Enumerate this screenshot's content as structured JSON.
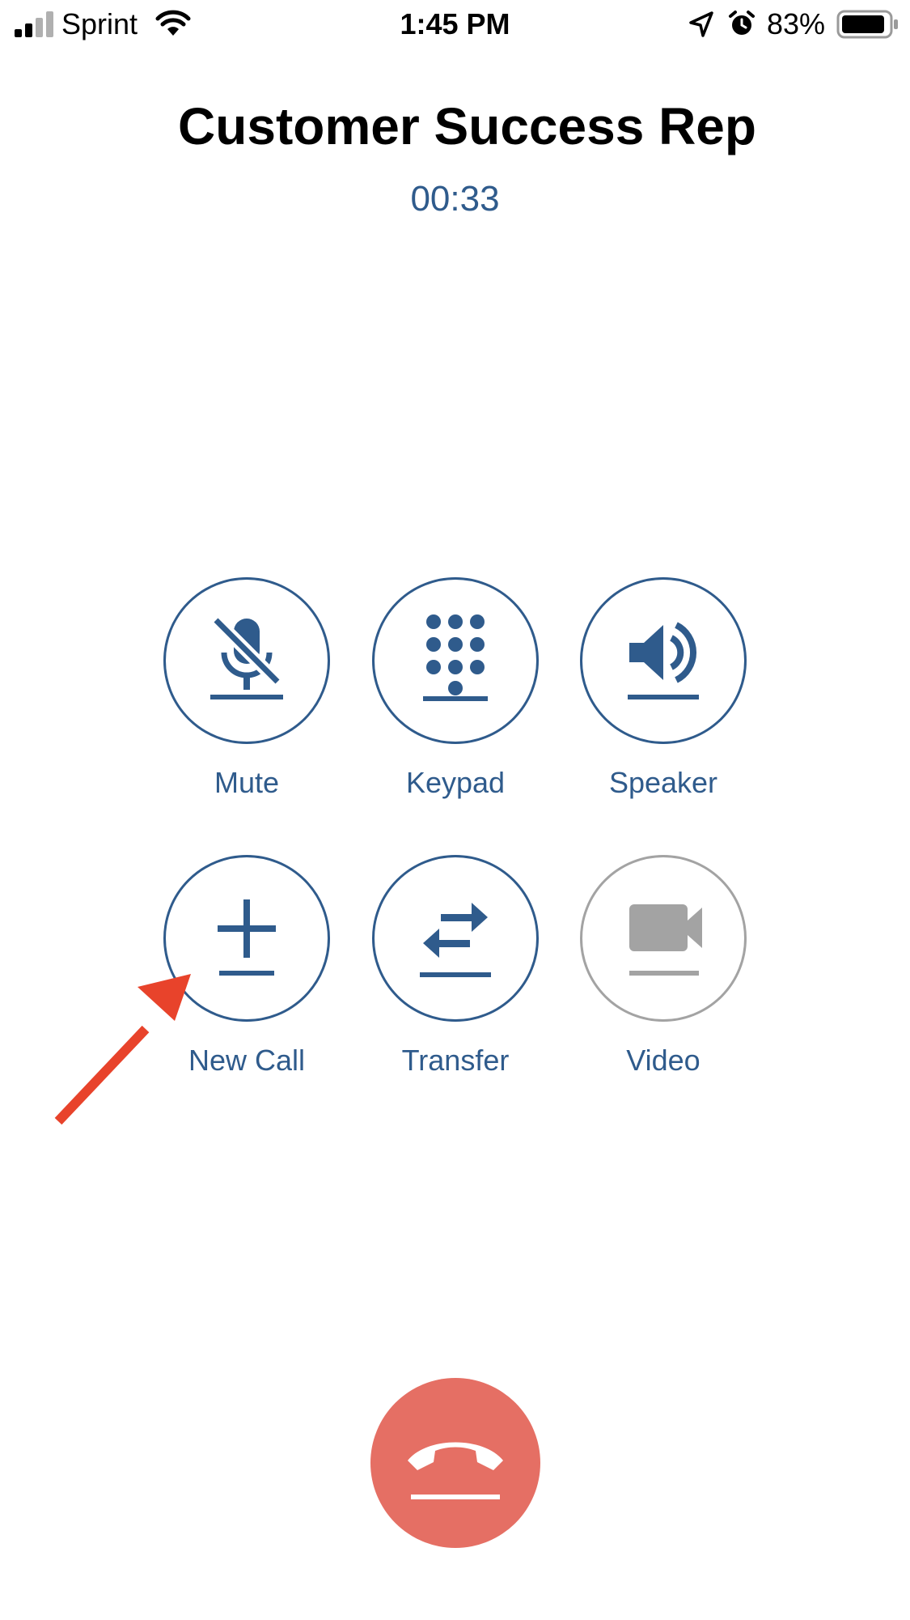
{
  "status_bar": {
    "carrier": "Sprint",
    "time": "1:45 PM",
    "battery_percent": "83%",
    "icons": [
      "signal-bars-icon",
      "wifi-icon",
      "location-arrow-icon",
      "alarm-clock-icon",
      "battery-icon"
    ]
  },
  "call": {
    "name": "Customer Success Rep",
    "duration": "00:33"
  },
  "controls": [
    {
      "label": "Mute",
      "icon": "mute-microphone-icon",
      "enabled": true
    },
    {
      "label": "Keypad",
      "icon": "keypad-icon",
      "enabled": true
    },
    {
      "label": "Speaker",
      "icon": "speaker-icon",
      "enabled": true
    },
    {
      "label": "New Call",
      "icon": "plus-icon",
      "enabled": true
    },
    {
      "label": "Transfer",
      "icon": "transfer-arrows-icon",
      "enabled": true
    },
    {
      "label": "Video",
      "icon": "video-camera-icon",
      "enabled": false
    }
  ],
  "end_call": {
    "icon": "hang-up-icon"
  },
  "colors": {
    "accent": "#2f5b8c",
    "disabled": "#a3a3a3",
    "end_call": "#e56f64",
    "annotation": "#e8432b"
  }
}
